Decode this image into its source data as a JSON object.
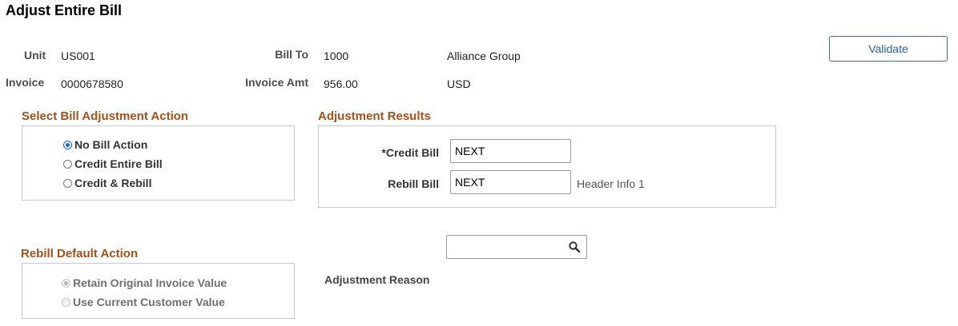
{
  "page": {
    "title": "Adjust Entire Bill"
  },
  "header": {
    "unit_label": "Unit",
    "unit_value": "US001",
    "bill_to_label": "Bill To",
    "bill_to_value": "1000",
    "bill_to_name": "Alliance Group",
    "invoice_label": "Invoice",
    "invoice_value": "0000678580",
    "invoice_amt_label": "Invoice Amt",
    "invoice_amt_value": "956.00",
    "currency": "USD"
  },
  "toolbar": {
    "validate_label": "Validate"
  },
  "bill_adjustment_action": {
    "title": "Select Bill Adjustment Action",
    "options": [
      {
        "label": "No Bill Action",
        "selected": true
      },
      {
        "label": "Credit Entire Bill",
        "selected": false
      },
      {
        "label": "Credit & Rebill",
        "selected": false
      }
    ]
  },
  "adjustment_results": {
    "title": "Adjustment Results",
    "credit_bill_label": "*Credit Bill",
    "credit_bill_value": "NEXT",
    "rebill_bill_label": "Rebill Bill",
    "rebill_bill_value": "NEXT",
    "header_info_link": "Header Info 1"
  },
  "rebill_default_action": {
    "title": "Rebill Default Action",
    "options": [
      {
        "label": "Retain Original Invoice Value",
        "selected": true,
        "disabled": true
      },
      {
        "label": "Use Current Customer Value",
        "selected": false,
        "disabled": true
      }
    ]
  },
  "adjustment_reason": {
    "label": "Adjustment Reason",
    "value": "",
    "search_icon": "search-icon"
  },
  "colors": {
    "section_title": "#a0521d",
    "button_border": "#3b6ea5",
    "radio_selected": "#0f6bd8"
  }
}
